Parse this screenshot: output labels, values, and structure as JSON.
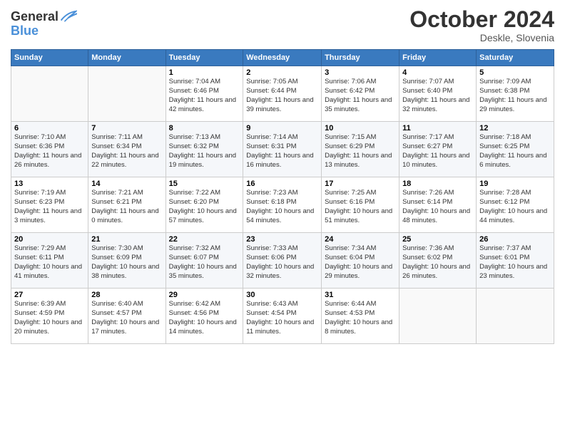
{
  "header": {
    "logo_line1": "General",
    "logo_line2": "Blue",
    "month_title": "October 2024",
    "location": "Deskle, Slovenia"
  },
  "weekdays": [
    "Sunday",
    "Monday",
    "Tuesday",
    "Wednesday",
    "Thursday",
    "Friday",
    "Saturday"
  ],
  "weeks": [
    [
      {
        "day": "",
        "info": ""
      },
      {
        "day": "",
        "info": ""
      },
      {
        "day": "1",
        "info": "Sunrise: 7:04 AM\nSunset: 6:46 PM\nDaylight: 11 hours and 42 minutes."
      },
      {
        "day": "2",
        "info": "Sunrise: 7:05 AM\nSunset: 6:44 PM\nDaylight: 11 hours and 39 minutes."
      },
      {
        "day": "3",
        "info": "Sunrise: 7:06 AM\nSunset: 6:42 PM\nDaylight: 11 hours and 35 minutes."
      },
      {
        "day": "4",
        "info": "Sunrise: 7:07 AM\nSunset: 6:40 PM\nDaylight: 11 hours and 32 minutes."
      },
      {
        "day": "5",
        "info": "Sunrise: 7:09 AM\nSunset: 6:38 PM\nDaylight: 11 hours and 29 minutes."
      }
    ],
    [
      {
        "day": "6",
        "info": "Sunrise: 7:10 AM\nSunset: 6:36 PM\nDaylight: 11 hours and 26 minutes."
      },
      {
        "day": "7",
        "info": "Sunrise: 7:11 AM\nSunset: 6:34 PM\nDaylight: 11 hours and 22 minutes."
      },
      {
        "day": "8",
        "info": "Sunrise: 7:13 AM\nSunset: 6:32 PM\nDaylight: 11 hours and 19 minutes."
      },
      {
        "day": "9",
        "info": "Sunrise: 7:14 AM\nSunset: 6:31 PM\nDaylight: 11 hours and 16 minutes."
      },
      {
        "day": "10",
        "info": "Sunrise: 7:15 AM\nSunset: 6:29 PM\nDaylight: 11 hours and 13 minutes."
      },
      {
        "day": "11",
        "info": "Sunrise: 7:17 AM\nSunset: 6:27 PM\nDaylight: 11 hours and 10 minutes."
      },
      {
        "day": "12",
        "info": "Sunrise: 7:18 AM\nSunset: 6:25 PM\nDaylight: 11 hours and 6 minutes."
      }
    ],
    [
      {
        "day": "13",
        "info": "Sunrise: 7:19 AM\nSunset: 6:23 PM\nDaylight: 11 hours and 3 minutes."
      },
      {
        "day": "14",
        "info": "Sunrise: 7:21 AM\nSunset: 6:21 PM\nDaylight: 11 hours and 0 minutes."
      },
      {
        "day": "15",
        "info": "Sunrise: 7:22 AM\nSunset: 6:20 PM\nDaylight: 10 hours and 57 minutes."
      },
      {
        "day": "16",
        "info": "Sunrise: 7:23 AM\nSunset: 6:18 PM\nDaylight: 10 hours and 54 minutes."
      },
      {
        "day": "17",
        "info": "Sunrise: 7:25 AM\nSunset: 6:16 PM\nDaylight: 10 hours and 51 minutes."
      },
      {
        "day": "18",
        "info": "Sunrise: 7:26 AM\nSunset: 6:14 PM\nDaylight: 10 hours and 48 minutes."
      },
      {
        "day": "19",
        "info": "Sunrise: 7:28 AM\nSunset: 6:12 PM\nDaylight: 10 hours and 44 minutes."
      }
    ],
    [
      {
        "day": "20",
        "info": "Sunrise: 7:29 AM\nSunset: 6:11 PM\nDaylight: 10 hours and 41 minutes."
      },
      {
        "day": "21",
        "info": "Sunrise: 7:30 AM\nSunset: 6:09 PM\nDaylight: 10 hours and 38 minutes."
      },
      {
        "day": "22",
        "info": "Sunrise: 7:32 AM\nSunset: 6:07 PM\nDaylight: 10 hours and 35 minutes."
      },
      {
        "day": "23",
        "info": "Sunrise: 7:33 AM\nSunset: 6:06 PM\nDaylight: 10 hours and 32 minutes."
      },
      {
        "day": "24",
        "info": "Sunrise: 7:34 AM\nSunset: 6:04 PM\nDaylight: 10 hours and 29 minutes."
      },
      {
        "day": "25",
        "info": "Sunrise: 7:36 AM\nSunset: 6:02 PM\nDaylight: 10 hours and 26 minutes."
      },
      {
        "day": "26",
        "info": "Sunrise: 7:37 AM\nSunset: 6:01 PM\nDaylight: 10 hours and 23 minutes."
      }
    ],
    [
      {
        "day": "27",
        "info": "Sunrise: 6:39 AM\nSunset: 4:59 PM\nDaylight: 10 hours and 20 minutes."
      },
      {
        "day": "28",
        "info": "Sunrise: 6:40 AM\nSunset: 4:57 PM\nDaylight: 10 hours and 17 minutes."
      },
      {
        "day": "29",
        "info": "Sunrise: 6:42 AM\nSunset: 4:56 PM\nDaylight: 10 hours and 14 minutes."
      },
      {
        "day": "30",
        "info": "Sunrise: 6:43 AM\nSunset: 4:54 PM\nDaylight: 10 hours and 11 minutes."
      },
      {
        "day": "31",
        "info": "Sunrise: 6:44 AM\nSunset: 4:53 PM\nDaylight: 10 hours and 8 minutes."
      },
      {
        "day": "",
        "info": ""
      },
      {
        "day": "",
        "info": ""
      }
    ]
  ]
}
